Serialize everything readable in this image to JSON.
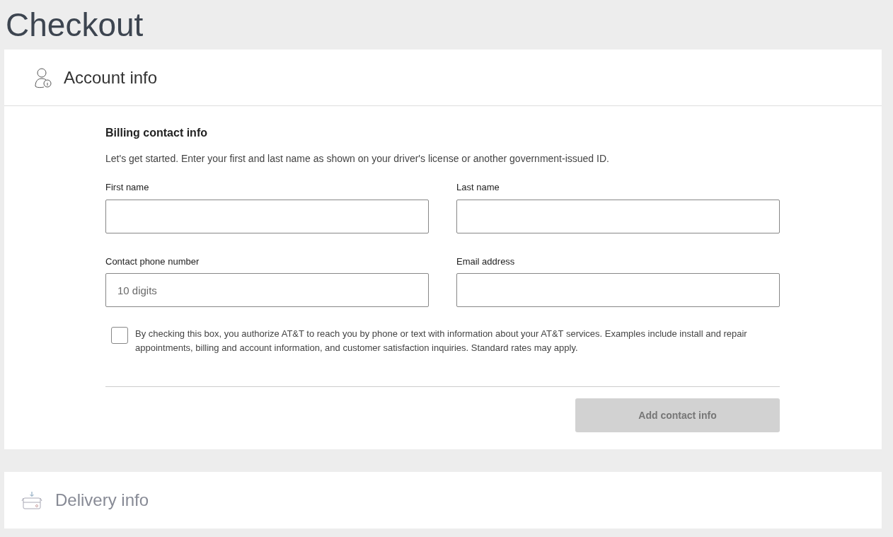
{
  "page_title": "Checkout",
  "account_section": {
    "heading": "Account info",
    "form": {
      "title": "Billing contact info",
      "intro": "Let's get started. Enter your first and last name as shown on your driver's license or another government-issued ID.",
      "fields": [
        {
          "label": "First name"
        },
        {
          "label": "Last name"
        },
        {
          "label": "Contact phone number",
          "placeholder": "10 digits"
        },
        {
          "label": "Email address"
        }
      ],
      "consent": {
        "checked": false,
        "text": "By checking this box, you authorize AT&T to reach you by phone or text with information about your AT&T services. Examples include install and repair appointments, billing and account information, and customer satisfaction inquiries. Standard rates may apply."
      },
      "submit": {
        "label": "Add contact info",
        "disabled": true
      }
    }
  },
  "delivery_section": {
    "heading": "Delivery info",
    "disabled": true
  }
}
